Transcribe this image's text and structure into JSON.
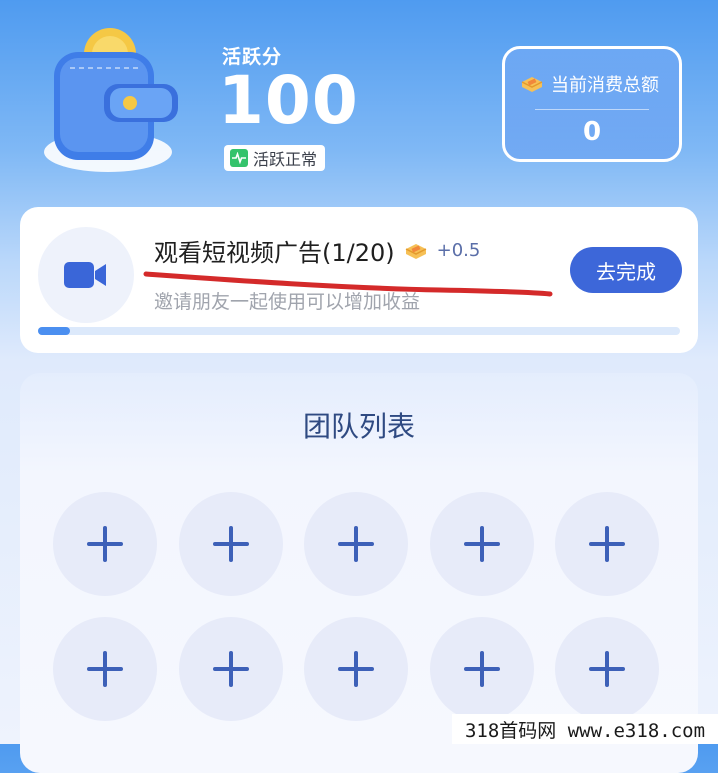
{
  "header": {
    "score_label": "活跃分",
    "score_value": "100",
    "status_text": "活跃正常",
    "total_label": "当前消费总额",
    "total_value": "0"
  },
  "task": {
    "title": "观看短视频广告(1/20)",
    "reward": "+0.5",
    "description": "邀请朋友一起使用可以增加收益",
    "button_label": "去完成",
    "progress": 0.05
  },
  "team": {
    "title": "团队列表",
    "slot_count": 10
  },
  "watermark": "318首码网  www.e318.com",
  "colors": {
    "accent": "#3d67d9",
    "status_green": "#34c36b",
    "scribble": "#d42a2a"
  },
  "icons": {
    "wallet": "wallet-icon",
    "pulse": "pulse-icon",
    "ingot": "gold-ingot-icon",
    "video": "video-camera-icon",
    "plus": "plus-icon"
  }
}
